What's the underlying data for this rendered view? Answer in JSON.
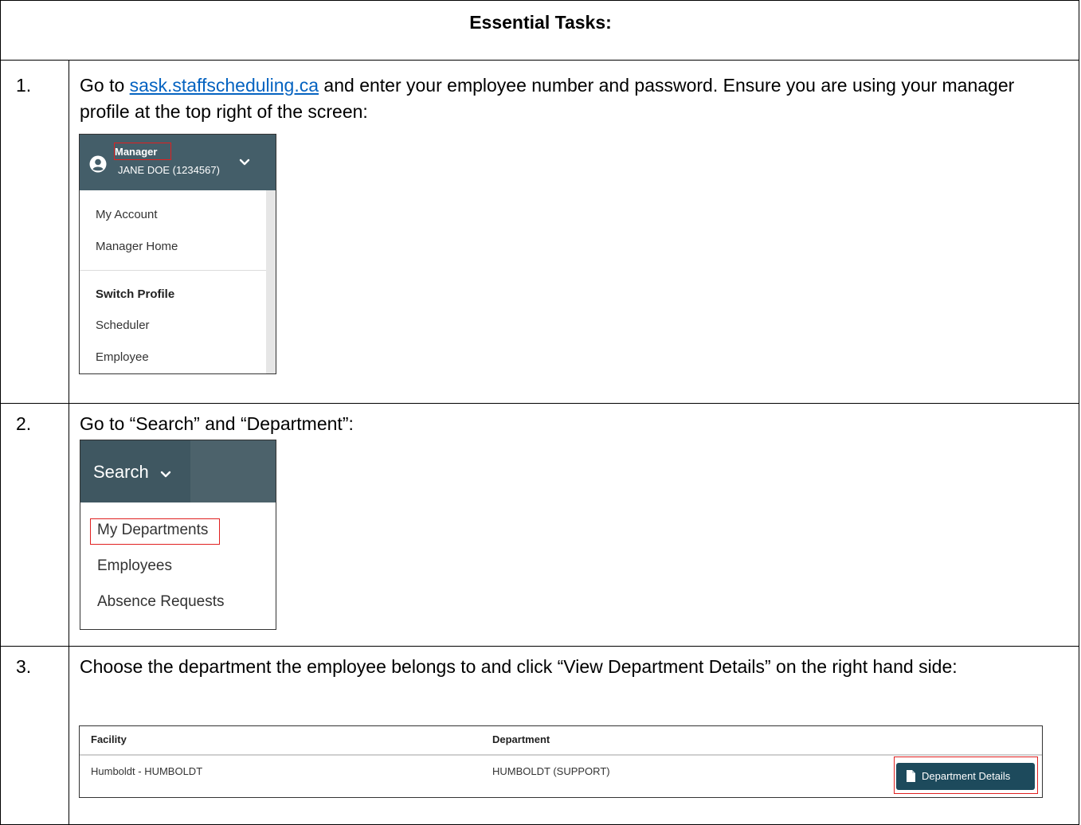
{
  "header": {
    "title": "Essential Tasks:"
  },
  "steps": [
    {
      "number": "1.",
      "text_before_link": "Go to ",
      "link_text": "sask.staffscheduling.ca",
      "text_after_link": " and enter your employee number and password. Ensure you are using your manager profile at the top right of the screen:"
    },
    {
      "number": "2.",
      "text": "Go to “Search” and “Department”:"
    },
    {
      "number": "3.",
      "text": "Choose the department the employee belongs to and click “View Department Details” on the right hand side:"
    }
  ],
  "profile_menu": {
    "role": "Manager",
    "user": "JANE DOE (1234567)",
    "items": [
      "My Account",
      "Manager Home"
    ],
    "switch_heading": "Switch Profile",
    "profiles": [
      "Scheduler",
      "Employee"
    ],
    "colors": {
      "header_bg": "#445e69",
      "highlight": "#e02020"
    }
  },
  "search_menu": {
    "label": "Search",
    "items": [
      "My Departments",
      "Employees",
      "Absence Requests"
    ],
    "colors": {
      "header_bg": "#4c626b"
    }
  },
  "department_table": {
    "columns": [
      "Facility",
      "Department"
    ],
    "rows": [
      {
        "facility": "Humboldt - HUMBOLDT",
        "department": "HUMBOLDT (SUPPORT)"
      }
    ],
    "button_label": "Department Details",
    "colors": {
      "button_bg": "#1d4a5c"
    }
  }
}
